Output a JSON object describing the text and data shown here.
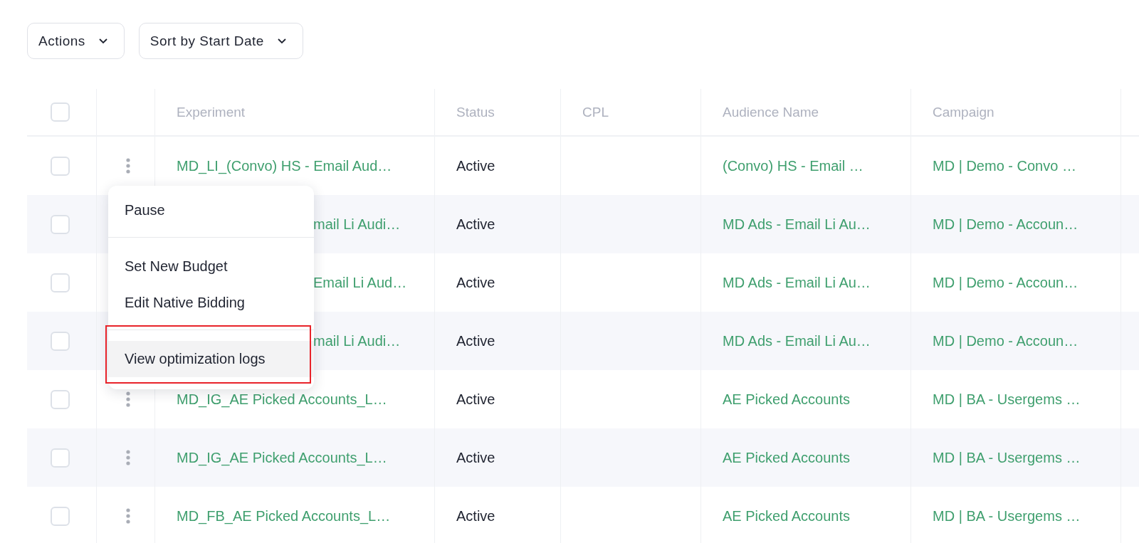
{
  "toolbar": {
    "buttons": [
      {
        "label": "Actions"
      },
      {
        "label": "Sort by Start Date"
      }
    ]
  },
  "table": {
    "select_all": {
      "checked": false
    },
    "columns": [
      "Experiment",
      "Status",
      "CPL",
      "Audience Name",
      "Campaign"
    ],
    "rows": [
      {
        "checked": false,
        "covered_by_menu": false,
        "experiment": "MD_LI_(Convo) HS - Email Aud…",
        "status": "Active",
        "audience": "(Convo) HS - Email …",
        "campaign": "MD | Demo - Convo …"
      },
      {
        "checked": false,
        "covered_by_menu": true,
        "experiment": "mail Li Audi…",
        "status": "Active",
        "audience": "MD Ads - Email Li Au…",
        "campaign": "MD | Demo - Accoun…"
      },
      {
        "checked": false,
        "covered_by_menu": true,
        "experiment": "Email Li Aud…",
        "status": "Active",
        "audience": "MD Ads - Email Li Au…",
        "campaign": "MD | Demo - Accoun…"
      },
      {
        "checked": false,
        "covered_by_menu": true,
        "experiment": "mail Li Audi…",
        "status": "Active",
        "audience": "MD Ads - Email Li Au…",
        "campaign": "MD | Demo - Accoun…"
      },
      {
        "checked": false,
        "covered_by_menu": false,
        "experiment": "MD_IG_AE Picked Accounts_L…",
        "status": "Active",
        "audience": "AE Picked Accounts",
        "campaign": "MD | BA - Usergems …"
      },
      {
        "checked": false,
        "covered_by_menu": false,
        "experiment": "MD_IG_AE Picked Accounts_L…",
        "status": "Active",
        "audience": "AE Picked Accounts",
        "campaign": "MD | BA - Usergems …"
      },
      {
        "checked": false,
        "covered_by_menu": false,
        "experiment": "MD_FB_AE Picked Accounts_L…",
        "status": "Active",
        "audience": "AE Picked Accounts",
        "campaign": "MD | BA - Usergems …"
      }
    ]
  },
  "row_menu": {
    "red_frame": true,
    "groups": [
      [
        {
          "label": "Pause",
          "selected": false
        }
      ],
      [
        {
          "label": "Set New Budget",
          "selected": false
        },
        {
          "label": "Edit Native Bidding",
          "selected": false
        }
      ],
      [
        {
          "label": "View optimization logs",
          "selected": true
        }
      ]
    ]
  }
}
